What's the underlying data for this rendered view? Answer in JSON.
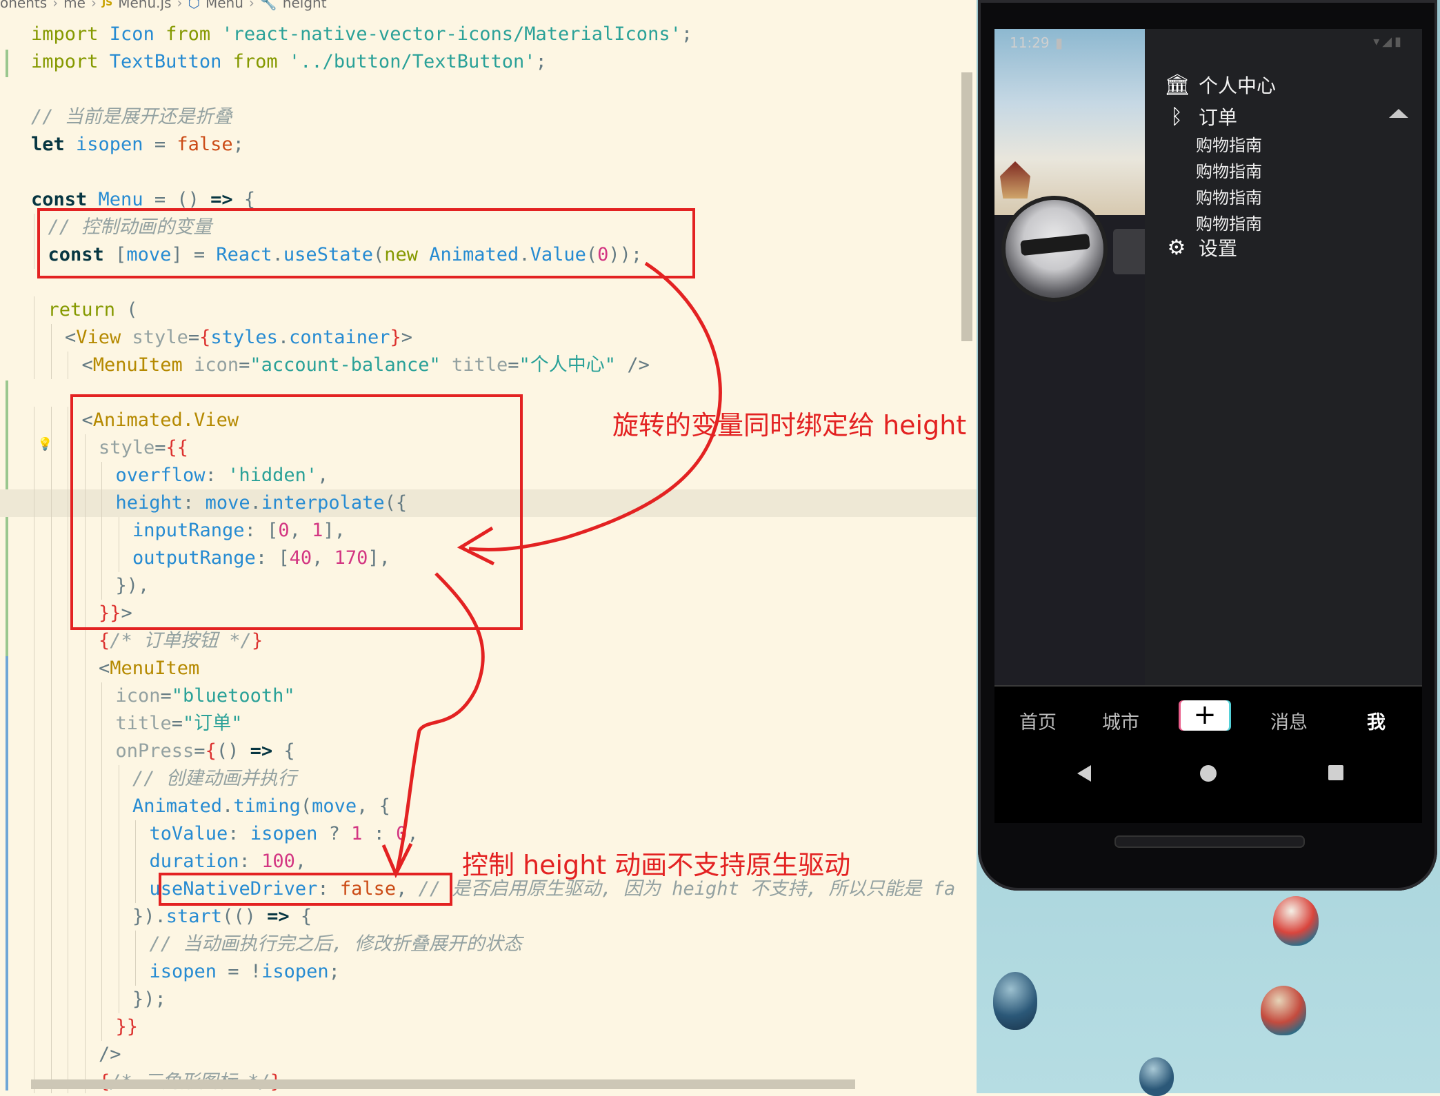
{
  "breadcrumb": [
    "onents",
    "me",
    "Menu.js",
    "Menu",
    "height"
  ],
  "code_lines": [
    {
      "indent": 0,
      "tokens": [
        [
          "kw",
          "import "
        ],
        [
          "id",
          "Icon "
        ],
        [
          "kw",
          "from "
        ],
        [
          "str",
          "'react-native-vector-icons/MaterialIcons'"
        ],
        [
          "punc",
          ";"
        ]
      ]
    },
    {
      "indent": 0,
      "tokens": [
        [
          "kw",
          "import "
        ],
        [
          "id",
          "TextButton "
        ],
        [
          "kw",
          "from "
        ],
        [
          "str",
          "'../button/TextButton'"
        ],
        [
          "punc",
          ";"
        ]
      ]
    },
    {
      "indent": 0,
      "tokens": []
    },
    {
      "indent": 0,
      "tokens": [
        [
          "com",
          "// 当前是展开还是折叠"
        ]
      ]
    },
    {
      "indent": 0,
      "tokens": [
        [
          "kw2",
          "let "
        ],
        [
          "id",
          "isopen "
        ],
        [
          "punc",
          "= "
        ],
        [
          "orange",
          "false"
        ],
        [
          "punc",
          ";"
        ]
      ]
    },
    {
      "indent": 0,
      "tokens": []
    },
    {
      "indent": 0,
      "tokens": [
        [
          "kw2",
          "const "
        ],
        [
          "id",
          "Menu "
        ],
        [
          "punc",
          "= () "
        ],
        [
          "kw2",
          "=> "
        ],
        [
          "punc",
          "{"
        ]
      ]
    },
    {
      "indent": 1,
      "tokens": [
        [
          "com",
          "// 控制动画的变量"
        ]
      ]
    },
    {
      "indent": 1,
      "tokens": [
        [
          "kw2",
          "const "
        ],
        [
          "punc",
          "["
        ],
        [
          "id",
          "move"
        ],
        [
          "punc",
          "] = "
        ],
        [
          "id",
          "React"
        ],
        [
          "punc",
          "."
        ],
        [
          "id",
          "useState"
        ],
        [
          "punc",
          "("
        ],
        [
          "kw",
          "new "
        ],
        [
          "id",
          "Animated"
        ],
        [
          "punc",
          "."
        ],
        [
          "id",
          "Value"
        ],
        [
          "punc",
          "("
        ],
        [
          "num",
          "0"
        ],
        [
          "punc",
          "));"
        ]
      ]
    },
    {
      "indent": 0,
      "tokens": []
    },
    {
      "indent": 1,
      "tokens": [
        [
          "kw",
          "return "
        ],
        [
          "punc",
          "("
        ]
      ]
    },
    {
      "indent": 2,
      "tokens": [
        [
          "punc",
          "<"
        ],
        [
          "tag",
          "View "
        ],
        [
          "attr",
          "style"
        ],
        [
          "punc",
          "="
        ],
        [
          "brace",
          "{"
        ],
        [
          "id",
          "styles"
        ],
        [
          "punc",
          "."
        ],
        [
          "id",
          "container"
        ],
        [
          "brace",
          "}"
        ],
        [
          "punc",
          ">"
        ]
      ]
    },
    {
      "indent": 3,
      "tokens": [
        [
          "punc",
          "<"
        ],
        [
          "tag",
          "MenuItem "
        ],
        [
          "attr",
          "icon"
        ],
        [
          "punc",
          "="
        ],
        [
          "str",
          "\"account-balance\" "
        ],
        [
          "attr",
          "title"
        ],
        [
          "punc",
          "="
        ],
        [
          "str",
          "\"个人中心\" "
        ],
        [
          "punc",
          "/>"
        ]
      ]
    },
    {
      "indent": 0,
      "tokens": []
    },
    {
      "indent": 3,
      "tokens": [
        [
          "punc",
          "<"
        ],
        [
          "tag",
          "Animated.View"
        ]
      ]
    },
    {
      "indent": 4,
      "tokens": [
        [
          "attr",
          "style"
        ],
        [
          "punc",
          "="
        ],
        [
          "brace",
          "{{"
        ]
      ]
    },
    {
      "indent": 5,
      "tokens": [
        [
          "id",
          "overflow"
        ],
        [
          "punc",
          ": "
        ],
        [
          "str",
          "'hidden'"
        ],
        [
          "punc",
          ","
        ]
      ]
    },
    {
      "indent": 5,
      "hl": true,
      "tokens": [
        [
          "id",
          "height"
        ],
        [
          "punc",
          ": "
        ],
        [
          "id",
          "move"
        ],
        [
          "punc",
          "."
        ],
        [
          "id",
          "interpolate"
        ],
        [
          "punc",
          "({"
        ]
      ]
    },
    {
      "indent": 6,
      "tokens": [
        [
          "id",
          "inputRange"
        ],
        [
          "punc",
          ": ["
        ],
        [
          "num",
          "0"
        ],
        [
          "punc",
          ", "
        ],
        [
          "num",
          "1"
        ],
        [
          "punc",
          "],"
        ]
      ]
    },
    {
      "indent": 6,
      "tokens": [
        [
          "id",
          "outputRange"
        ],
        [
          "punc",
          ": ["
        ],
        [
          "num",
          "40"
        ],
        [
          "punc",
          ", "
        ],
        [
          "num",
          "170"
        ],
        [
          "punc",
          "],"
        ]
      ]
    },
    {
      "indent": 5,
      "tokens": [
        [
          "punc",
          "}),"
        ]
      ]
    },
    {
      "indent": 4,
      "tokens": [
        [
          "brace",
          "}}"
        ],
        [
          "punc",
          ">"
        ]
      ]
    },
    {
      "indent": 4,
      "tokens": [
        [
          "brace",
          "{"
        ],
        [
          "com",
          "/* 订单按钮 */"
        ],
        [
          "brace",
          "}"
        ]
      ]
    },
    {
      "indent": 4,
      "tokens": [
        [
          "punc",
          "<"
        ],
        [
          "tag",
          "MenuItem"
        ]
      ]
    },
    {
      "indent": 5,
      "tokens": [
        [
          "attr",
          "icon"
        ],
        [
          "punc",
          "="
        ],
        [
          "str",
          "\"bluetooth\""
        ]
      ]
    },
    {
      "indent": 5,
      "tokens": [
        [
          "attr",
          "title"
        ],
        [
          "punc",
          "="
        ],
        [
          "str",
          "\"订单\""
        ]
      ]
    },
    {
      "indent": 5,
      "tokens": [
        [
          "attr",
          "onPress"
        ],
        [
          "punc",
          "="
        ],
        [
          "brace",
          "{"
        ],
        [
          "punc",
          "() "
        ],
        [
          "kw2",
          "=> "
        ],
        [
          "punc",
          "{"
        ]
      ]
    },
    {
      "indent": 6,
      "tokens": [
        [
          "com",
          "// 创建动画并执行"
        ]
      ]
    },
    {
      "indent": 6,
      "tokens": [
        [
          "id",
          "Animated"
        ],
        [
          "punc",
          "."
        ],
        [
          "id",
          "timing"
        ],
        [
          "punc",
          "("
        ],
        [
          "id",
          "move"
        ],
        [
          "punc",
          ", {"
        ]
      ]
    },
    {
      "indent": 7,
      "tokens": [
        [
          "id",
          "toValue"
        ],
        [
          "punc",
          ": "
        ],
        [
          "id",
          "isopen "
        ],
        [
          "punc",
          "? "
        ],
        [
          "num",
          "1 "
        ],
        [
          "punc",
          ": "
        ],
        [
          "num",
          "0"
        ],
        [
          "punc",
          ","
        ]
      ]
    },
    {
      "indent": 7,
      "tokens": [
        [
          "id",
          "duration"
        ],
        [
          "punc",
          ": "
        ],
        [
          "num",
          "100"
        ],
        [
          "punc",
          ","
        ]
      ]
    },
    {
      "indent": 7,
      "tokens": [
        [
          "id",
          "useNativeDriver"
        ],
        [
          "punc",
          ": "
        ],
        [
          "orange",
          "false"
        ],
        [
          "punc",
          ", "
        ],
        [
          "com",
          "// 是否启用原生驱动, 因为 height 不支持, 所以只能是 fa"
        ]
      ]
    },
    {
      "indent": 6,
      "tokens": [
        [
          "punc",
          "})."
        ],
        [
          "id",
          "start"
        ],
        [
          "punc",
          "(() "
        ],
        [
          "kw2",
          "=> "
        ],
        [
          "punc",
          "{"
        ]
      ]
    },
    {
      "indent": 7,
      "tokens": [
        [
          "com",
          "// 当动画执行完之后, 修改折叠展开的状态"
        ]
      ]
    },
    {
      "indent": 7,
      "tokens": [
        [
          "id",
          "isopen "
        ],
        [
          "punc",
          "= !"
        ],
        [
          "id",
          "isopen"
        ],
        [
          "punc",
          ";"
        ]
      ]
    },
    {
      "indent": 6,
      "tokens": [
        [
          "punc",
          "});"
        ]
      ]
    },
    {
      "indent": 5,
      "tokens": [
        [
          "brace",
          "}}"
        ]
      ]
    },
    {
      "indent": 4,
      "tokens": [
        [
          "punc",
          "/>"
        ]
      ]
    },
    {
      "indent": 4,
      "tokens": [
        [
          "brace",
          "{"
        ],
        [
          "com",
          "/* 三角形图标 */"
        ],
        [
          "brace",
          "}"
        ]
      ]
    }
  ],
  "annotations": {
    "note_height_binding": "旋转的变量同时绑定给 height",
    "note_native_driver": "控制 height 动画不支持原生驱动"
  },
  "colors": {
    "annotation_red": "#e32222",
    "editor_bg": "#fdf6e3"
  },
  "phone": {
    "status_time": "11:29",
    "drawer": {
      "items": [
        {
          "icon": "account-balance-icon",
          "label": "个人中心"
        },
        {
          "icon": "bluetooth-icon",
          "label": "订单",
          "expanded": true
        },
        {
          "icon": "settings-icon",
          "label": "设置"
        }
      ],
      "sub_items": [
        "购物指南",
        "购物指南",
        "购物指南",
        "购物指南"
      ]
    },
    "tabs": [
      "首页",
      "城市",
      "+",
      "消息",
      "我"
    ],
    "active_tab": "我"
  }
}
